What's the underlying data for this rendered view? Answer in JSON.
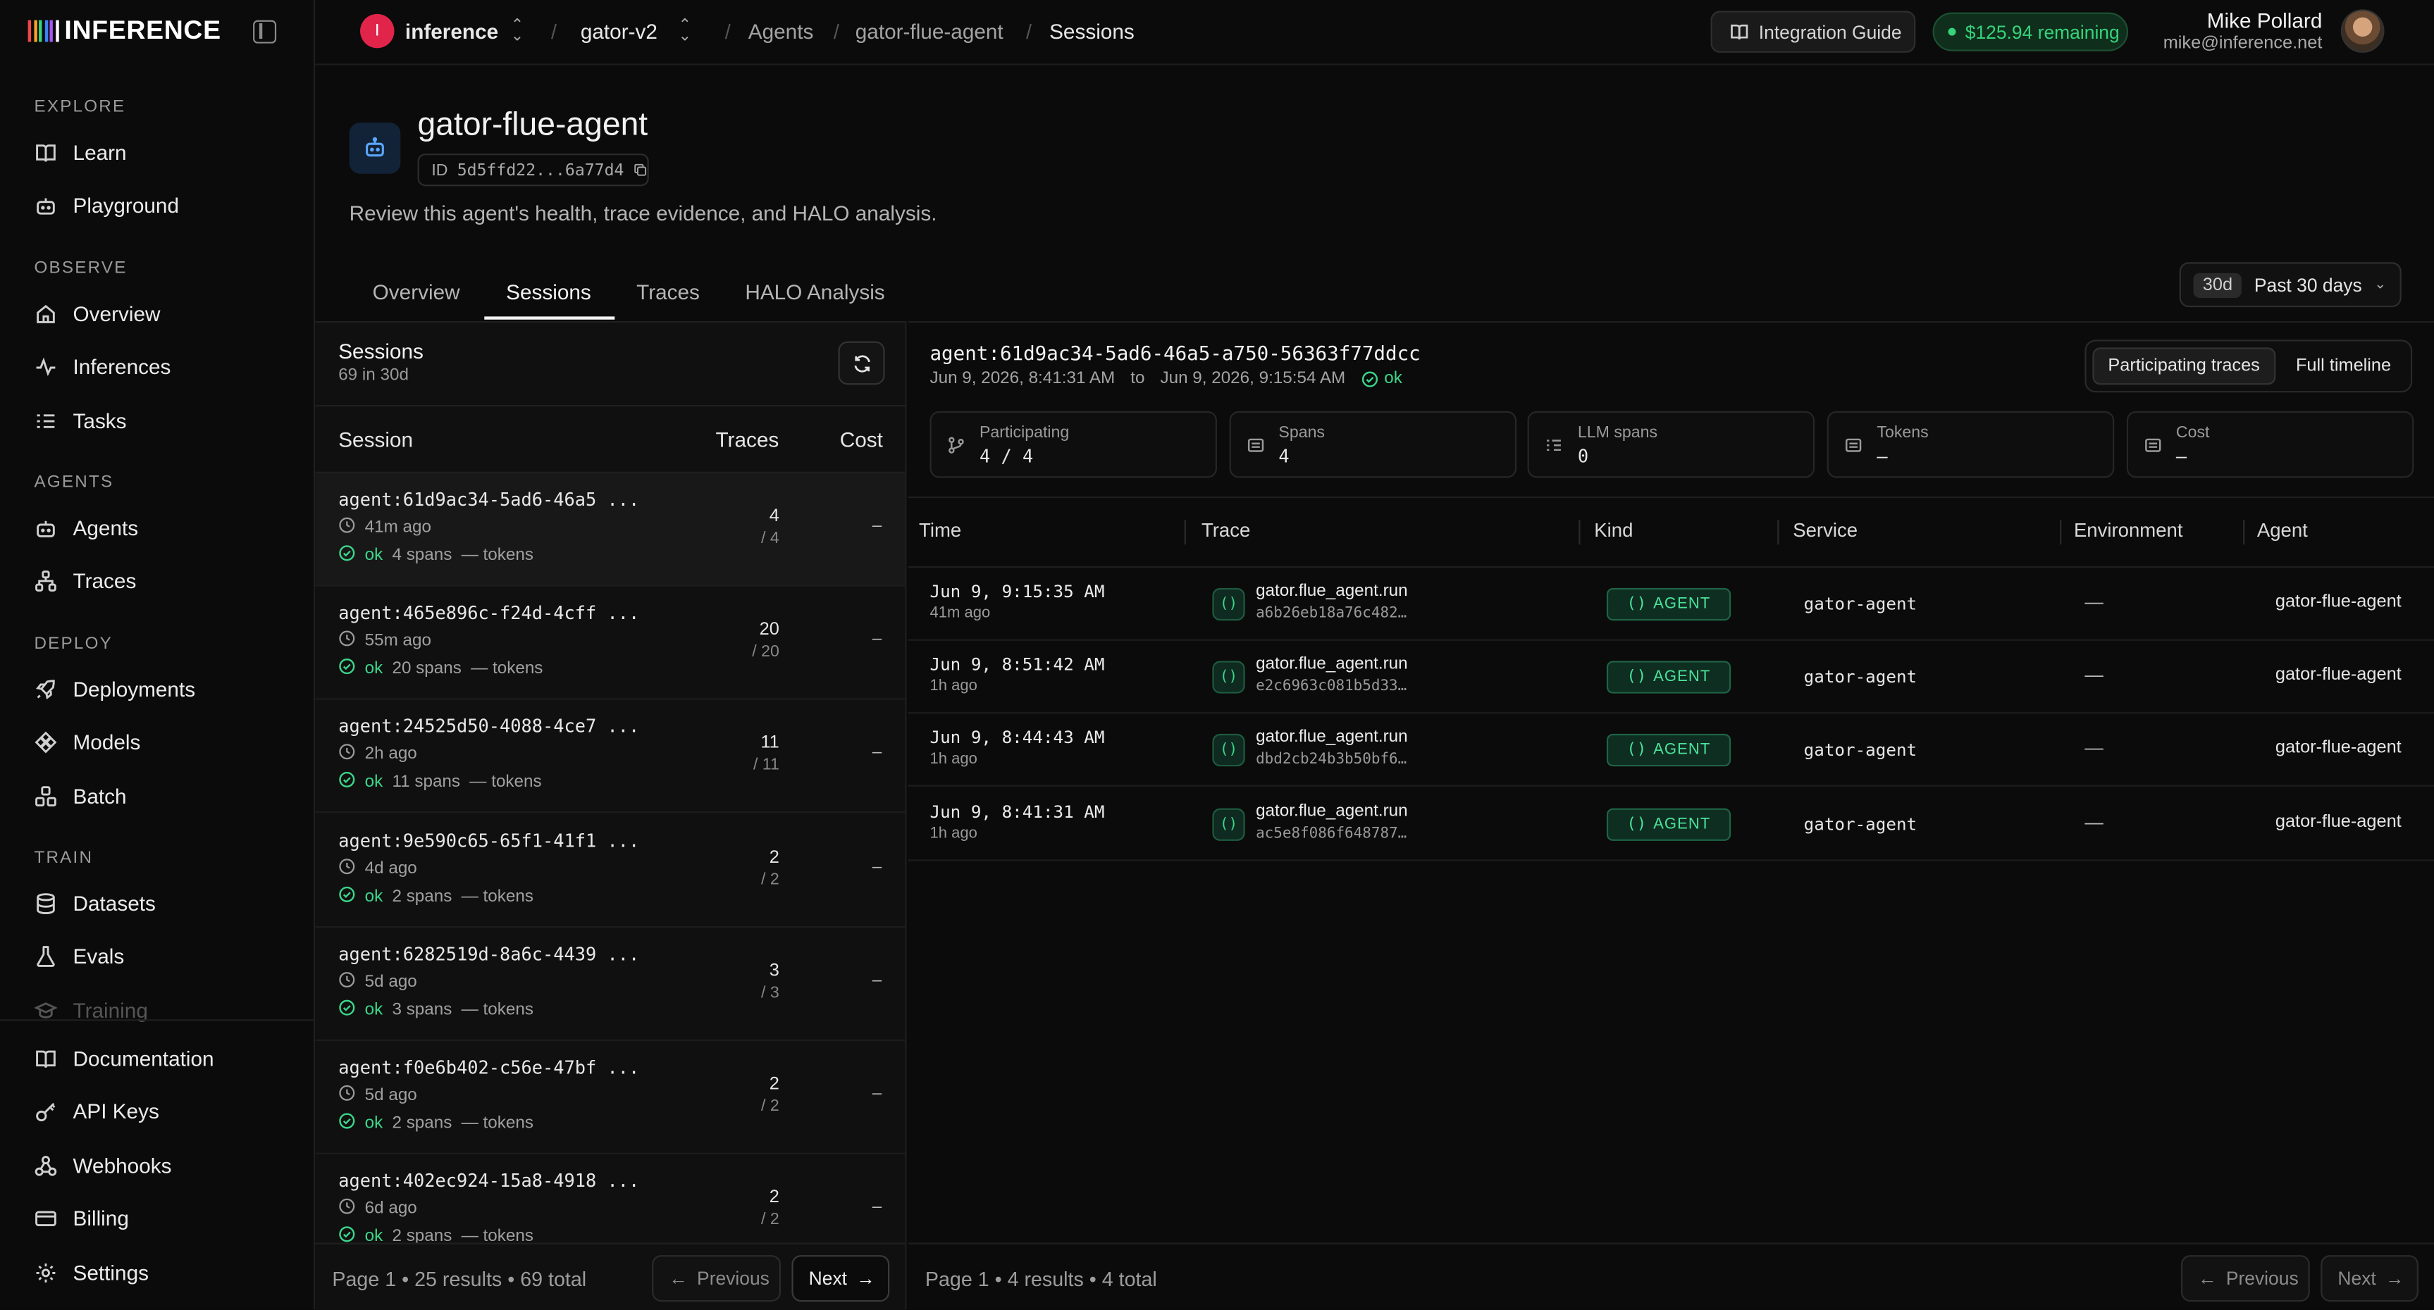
{
  "brand": {
    "name": "INFERENCE",
    "bar_colors": [
      "#f04646",
      "#f5a524",
      "#36d37a",
      "#3b82f6",
      "#a855f7",
      "#ffffff"
    ]
  },
  "sidebar": {
    "sections": [
      {
        "label": "EXPLORE",
        "items": [
          {
            "label": "Learn",
            "icon": "book-icon"
          },
          {
            "label": "Playground",
            "icon": "robot-icon"
          }
        ]
      },
      {
        "label": "OBSERVE",
        "items": [
          {
            "label": "Overview",
            "icon": "home-icon"
          },
          {
            "label": "Inferences",
            "icon": "activity-icon"
          },
          {
            "label": "Tasks",
            "icon": "list-icon"
          }
        ]
      },
      {
        "label": "AGENTS",
        "items": [
          {
            "label": "Agents",
            "icon": "robot-icon"
          },
          {
            "label": "Traces",
            "icon": "network-icon"
          }
        ]
      },
      {
        "label": "DEPLOY",
        "items": [
          {
            "label": "Deployments",
            "icon": "rocket-icon"
          },
          {
            "label": "Models",
            "icon": "models-icon"
          },
          {
            "label": "Batch",
            "icon": "batch-icon"
          }
        ]
      },
      {
        "label": "TRAIN",
        "items": [
          {
            "label": "Datasets",
            "icon": "database-icon"
          },
          {
            "label": "Evals",
            "icon": "flask-icon"
          },
          {
            "label": "Training",
            "icon": "training-icon"
          }
        ]
      }
    ],
    "bottom": [
      {
        "label": "Documentation",
        "icon": "book-icon"
      },
      {
        "label": "API Keys",
        "icon": "key-icon"
      },
      {
        "label": "Webhooks",
        "icon": "webhook-icon"
      },
      {
        "label": "Billing",
        "icon": "card-icon"
      },
      {
        "label": "Settings",
        "icon": "gear-icon"
      }
    ]
  },
  "topbar": {
    "org_initial": "I",
    "org": "inference",
    "project": "gator-v2",
    "breadcrumbs": [
      "Agents",
      "gator-flue-agent",
      "Sessions"
    ],
    "integration_guide": "Integration Guide",
    "credit": "$125.94 remaining",
    "user_name": "Mike Pollard",
    "user_email": "mike@inference.net"
  },
  "header": {
    "title": "gator-flue-agent",
    "id_label": "ID",
    "id_value": "5d5ffd22...6a77d4",
    "description": "Review this agent's health, trace evidence, and HALO analysis.",
    "tabs": [
      "Overview",
      "Sessions",
      "Traces",
      "HALO Analysis"
    ],
    "active_tab": "Sessions",
    "range_pill": "30d",
    "range_label": "Past 30 days"
  },
  "sessions": {
    "title": "Sessions",
    "subtitle": "69 in 30d",
    "columns": [
      "Session",
      "Traces",
      "Cost"
    ],
    "rows": [
      {
        "id": "agent:61d9ac34-5ad6-46a5 ...",
        "ago": "41m ago",
        "status": "ok",
        "spans": "4 spans",
        "tokens": "— tokens",
        "traces": "4",
        "traces_sub": "/ 4",
        "cost": "–"
      },
      {
        "id": "agent:465e896c-f24d-4cff ...",
        "ago": "55m ago",
        "status": "ok",
        "spans": "20 spans",
        "tokens": "— tokens",
        "traces": "20",
        "traces_sub": "/ 20",
        "cost": "–"
      },
      {
        "id": "agent:24525d50-4088-4ce7 ...",
        "ago": "2h ago",
        "status": "ok",
        "spans": "11 spans",
        "tokens": "— tokens",
        "traces": "11",
        "traces_sub": "/ 11",
        "cost": "–"
      },
      {
        "id": "agent:9e590c65-65f1-41f1 ...",
        "ago": "4d ago",
        "status": "ok",
        "spans": "2 spans",
        "tokens": "— tokens",
        "traces": "2",
        "traces_sub": "/ 2",
        "cost": "–"
      },
      {
        "id": "agent:6282519d-8a6c-4439 ...",
        "ago": "5d ago",
        "status": "ok",
        "spans": "3 spans",
        "tokens": "— tokens",
        "traces": "3",
        "traces_sub": "/ 3",
        "cost": "–"
      },
      {
        "id": "agent:f0e6b402-c56e-47bf ...",
        "ago": "5d ago",
        "status": "ok",
        "spans": "2 spans",
        "tokens": "— tokens",
        "traces": "2",
        "traces_sub": "/ 2",
        "cost": "–"
      },
      {
        "id": "agent:402ec924-15a8-4918 ...",
        "ago": "6d ago",
        "status": "ok",
        "spans": "2 spans",
        "tokens": "— tokens",
        "traces": "2",
        "traces_sub": "/ 2",
        "cost": "–"
      }
    ],
    "pager": {
      "text": "Page 1 • 25 results • 69 total",
      "previous": "Previous",
      "next": "Next"
    }
  },
  "detail": {
    "title": "agent:61d9ac34-5ad6-46a5-a750-56363f77ddcc",
    "start": "Jun 9, 2026, 8:41:31 AM",
    "to": "to",
    "end": "Jun 9, 2026, 9:15:54 AM",
    "status": "ok",
    "toggle": [
      "Participating traces",
      "Full timeline"
    ],
    "stats": [
      {
        "label": "Participating",
        "value": "4 / 4",
        "icon": "branch-icon"
      },
      {
        "label": "Spans",
        "value": "4",
        "icon": "spans-icon"
      },
      {
        "label": "LLM spans",
        "value": "0",
        "icon": "llm-spans-icon"
      },
      {
        "label": "Tokens",
        "value": "–",
        "icon": "tokens-icon"
      },
      {
        "label": "Cost",
        "value": "–",
        "icon": "cost-icon"
      }
    ],
    "columns": [
      "Time",
      "Trace",
      "Kind",
      "Service",
      "Environment",
      "Agent"
    ],
    "rows": [
      {
        "time": "Jun 9, 9:15:35 AM",
        "ago": "41m ago",
        "trace": "gator.flue_agent.run",
        "trace_id": "a6b26eb18a76c482…",
        "kind": "AGENT",
        "service": "gator-agent",
        "env": "—",
        "agent": "gator-flue-agent"
      },
      {
        "time": "Jun 9, 8:51:42 AM",
        "ago": "1h ago",
        "trace": "gator.flue_agent.run",
        "trace_id": "e2c6963c081b5d33…",
        "kind": "AGENT",
        "service": "gator-agent",
        "env": "—",
        "agent": "gator-flue-agent"
      },
      {
        "time": "Jun 9, 8:44:43 AM",
        "ago": "1h ago",
        "trace": "gator.flue_agent.run",
        "trace_id": "dbd2cb24b3b50bf6…",
        "kind": "AGENT",
        "service": "gator-agent",
        "env": "—",
        "agent": "gator-flue-agent"
      },
      {
        "time": "Jun 9, 8:41:31 AM",
        "ago": "1h ago",
        "trace": "gator.flue_agent.run",
        "trace_id": "ac5e8f086f648787…",
        "kind": "AGENT",
        "service": "gator-agent",
        "env": "—",
        "agent": "gator-flue-agent"
      }
    ],
    "pager": {
      "text": "Page 1 • 4 results • 4 total",
      "previous": "Previous",
      "next": "Next"
    }
  }
}
